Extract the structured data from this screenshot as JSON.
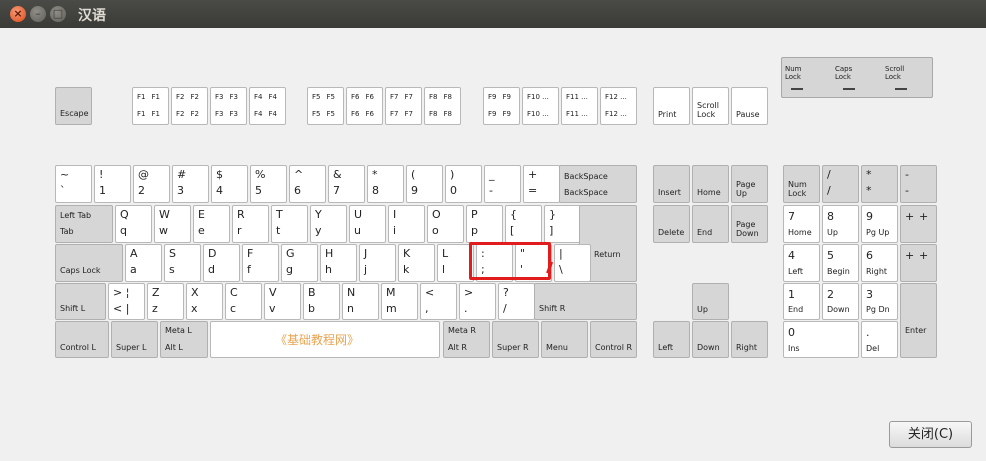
{
  "window": {
    "title": "汉语"
  },
  "colors": {
    "close": "#df4a16",
    "highlight": "#e21c1c",
    "space_label": "#e8a452",
    "key_gray": "#d6d6d6"
  },
  "keys": {
    "escape": "Escape",
    "f1_4": [
      "F1",
      "F1",
      "F2",
      "F2",
      "F3",
      "F3",
      "F4",
      "F4",
      "F1",
      "F1",
      "F2",
      "F2",
      "F3",
      "F3",
      "F4",
      "F4"
    ],
    "f5_8": [
      "F5",
      "F5",
      "F6",
      "F6",
      "F7",
      "F7",
      "F8",
      "F8",
      "F5",
      "F5",
      "F6",
      "F6",
      "F7",
      "F7",
      "F8",
      "F8"
    ],
    "f9_12": [
      "F9",
      "F9",
      "F10 ...",
      "F11 ...",
      "F12 ...",
      "F9",
      "F9",
      "F10 ...",
      "F11 ...",
      "F12 ..."
    ],
    "print": "Print",
    "scroll_lock": "Scroll\nLock",
    "pause": "Pause",
    "num_lock": "Num\nLock",
    "caps_lock_ind": "Caps\nLock",
    "scroll_lock_ind": "Scroll\nLock",
    "row1": [
      [
        "~",
        "`"
      ],
      [
        "!",
        "1"
      ],
      [
        "@",
        "2"
      ],
      [
        "#",
        "3"
      ],
      [
        "$",
        "4"
      ],
      [
        "%",
        "5"
      ],
      [
        "^",
        "6"
      ],
      [
        "&",
        "7"
      ],
      [
        "*",
        "8"
      ],
      [
        "(",
        "9"
      ],
      [
        ")",
        "0"
      ],
      [
        "_",
        "-"
      ],
      [
        "+",
        "="
      ]
    ],
    "backspace": [
      "BackSpace",
      "BackSpace"
    ],
    "insert": "Insert",
    "home": "Home",
    "page_up": "Page\nUp",
    "delete": "Delete",
    "end": "End",
    "page_down": "Page\nDown",
    "np_numlock": "Num\nLock",
    "np_div": [
      "/",
      "/"
    ],
    "np_mul": [
      "*",
      "*"
    ],
    "np_minus": [
      "-",
      "-"
    ],
    "tab": [
      "Left Tab",
      "Tab"
    ],
    "row2": [
      [
        "Q",
        "q"
      ],
      [
        "W",
        "w"
      ],
      [
        "E",
        "e"
      ],
      [
        "R",
        "r"
      ],
      [
        "T",
        "t"
      ],
      [
        "Y",
        "y"
      ],
      [
        "U",
        "u"
      ],
      [
        "I",
        "i"
      ],
      [
        "O",
        "o"
      ],
      [
        "P",
        "p"
      ],
      [
        "{",
        "["
      ],
      [
        "}",
        "]"
      ]
    ],
    "return": "Return",
    "np7": [
      "7",
      "Home"
    ],
    "np8": [
      "8",
      "Up"
    ],
    "np9": [
      "9",
      "Pg Up"
    ],
    "np_plus": [
      "+",
      "+"
    ],
    "caps_lock": "Caps Lock",
    "row3": [
      [
        "A",
        "a"
      ],
      [
        "S",
        "s"
      ],
      [
        "D",
        "d"
      ],
      [
        "F",
        "f"
      ],
      [
        "G",
        "g"
      ],
      [
        "H",
        "h"
      ],
      [
        "J",
        "j"
      ],
      [
        "K",
        "k"
      ],
      [
        "L",
        "l"
      ],
      [
        ":",
        ";"
      ],
      [
        "\"",
        "'"
      ],
      [
        "|",
        "\\"
      ]
    ],
    "np4": [
      "4",
      "Left"
    ],
    "np5": [
      "5",
      "Begin"
    ],
    "np6": [
      "6",
      "Right"
    ],
    "np_plus2": [
      "+",
      "+"
    ],
    "shift_l": "Shift L",
    "row4": [
      [
        "> ¦",
        "< |"
      ],
      [
        "Z",
        "z"
      ],
      [
        "X",
        "x"
      ],
      [
        "C",
        "c"
      ],
      [
        "V",
        "v"
      ],
      [
        "B",
        "b"
      ],
      [
        "N",
        "n"
      ],
      [
        "M",
        "m"
      ],
      [
        "<",
        ","
      ],
      [
        ">",
        "."
      ],
      [
        "?",
        "/"
      ]
    ],
    "shift_r": "Shift R",
    "up": "Up",
    "np1": [
      "1",
      "End"
    ],
    "np2": [
      "2",
      "Down"
    ],
    "np3": [
      "3",
      "Pg Dn"
    ],
    "enter": "Enter",
    "control_l": "Control L",
    "super_l": "Super L",
    "alt_l": [
      "Meta L",
      "Alt L"
    ],
    "space": "《基础教程网》",
    "alt_r": [
      "Meta R",
      "Alt R"
    ],
    "super_r": "Super R",
    "menu": "Menu",
    "control_r": "Control R",
    "left": "Left",
    "down": "Down",
    "right": "Right",
    "np0": [
      "0",
      "Ins"
    ],
    "np_dot": [
      ".",
      "Del"
    ]
  },
  "buttons": {
    "close": "关闭(C)"
  }
}
